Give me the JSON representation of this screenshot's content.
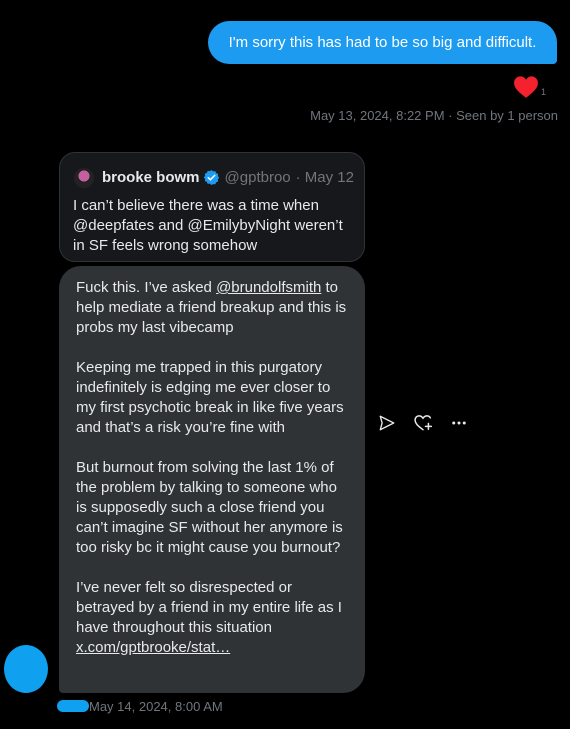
{
  "sent_message": {
    "text": "I'm sorry this has had to be so big and difficult.",
    "reaction_count": "1",
    "timestamp": "May 13, 2024, 8:22 PM",
    "separator": " · ",
    "seen": "Seen by 1 person"
  },
  "quoted_post": {
    "author_name": "brooke bowman",
    "handle": "@gptbroo",
    "date": "· May 12",
    "text": "I can’t believe there was a time when @deepfates and @EmilybyNight weren’t in SF feels wrong somehow"
  },
  "received_message": {
    "p1_pre": "Fuck this. I’ve asked ",
    "p1_mention": "@brundolfsmith",
    "p1_post": " to help mediate a friend breakup and this is probs my last vibecamp",
    "p2": "Keeping me trapped in this purgatory indefinitely is edging me ever closer to my first psychotic break in like five years and that’s a risk you’re fine with",
    "p3": "But burnout from solving the last 1% of the problem by talking to someone who is supposedly such a close  friend you can’t imagine SF without her anymore is too risky bc it might cause you burnout?",
    "p4": "I’ve never felt so disrespected or betrayed by a friend in my entire life as I have throughout  this situation",
    "link": "x.com/gptbrooke/stat…",
    "timestamp": "May 14, 2024, 8:00 AM"
  },
  "icons": {
    "reaction": "heart-icon",
    "share": "send-icon",
    "react": "heart-plus-icon",
    "more": "more-icon",
    "verified": "verified-badge-icon"
  },
  "colors": {
    "accent": "#1d9bf0",
    "heart": "#f91880",
    "bubble_received": "#2f3336",
    "muted_text": "#71767b"
  }
}
